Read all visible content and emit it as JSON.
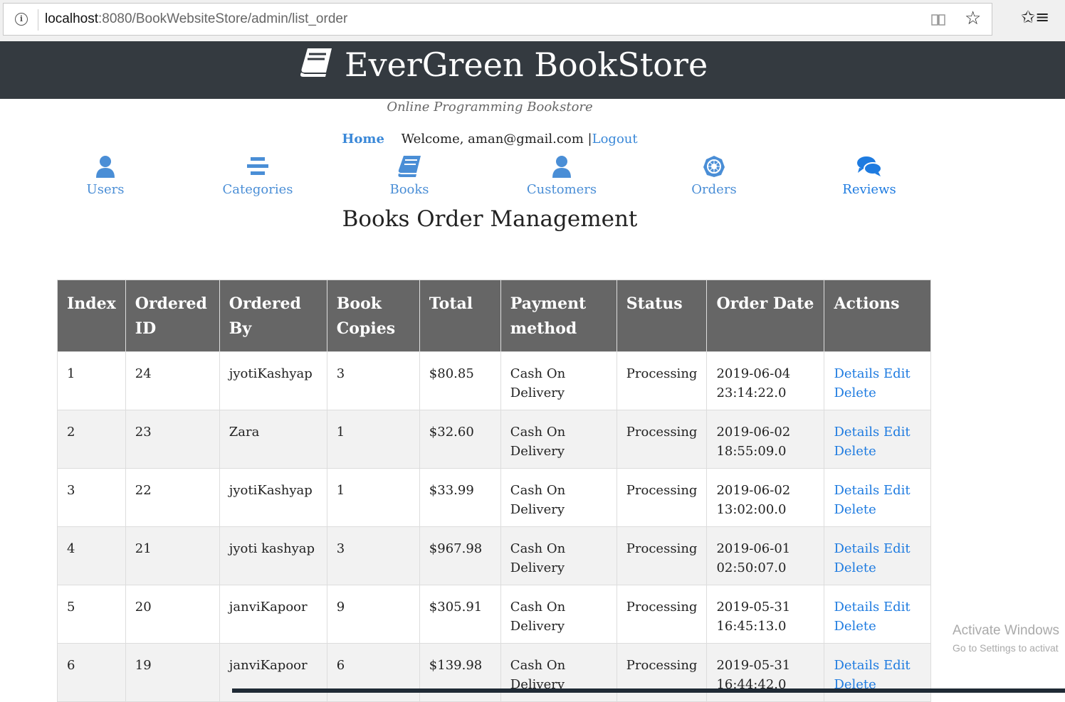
{
  "browser": {
    "url_host": "localhost",
    "url_rest": ":8080/BookWebsiteStore/admin/list_order",
    "info_icon": "info-icon",
    "star_icon": "star-icon",
    "favorites_icon": "favorites-icon"
  },
  "header": {
    "brand": "EverGreen BookStore",
    "tagline": "Online Programming Bookstore",
    "home_link": "Home",
    "welcome": "Welcome, aman@gmail.com |",
    "logout_link": "Logout"
  },
  "menu": [
    {
      "label": "Users",
      "icon": "user-icon"
    },
    {
      "label": "Categories",
      "icon": "bars-icon"
    },
    {
      "label": "Books",
      "icon": "book-icon"
    },
    {
      "label": "Customers",
      "icon": "user-icon"
    },
    {
      "label": "Orders",
      "icon": "gear-badge-icon"
    },
    {
      "label": "Reviews",
      "icon": "comments-icon"
    }
  ],
  "page_title": "Books Order Management",
  "table": {
    "headers": [
      "Index",
      "Ordered ID",
      "Ordered By",
      "Book Copies",
      "Total",
      "Payment method",
      "Status",
      "Order Date",
      "Actions"
    ],
    "rows": [
      {
        "index": "1",
        "id": "24",
        "by": "jyotiKashyap",
        "copies": "3",
        "total": "$80.85",
        "payment": "Cash On Delivery",
        "status": "Processing",
        "date": "2019-06-04 23:14:22.0"
      },
      {
        "index": "2",
        "id": "23",
        "by": "Zara",
        "copies": "1",
        "total": "$32.60",
        "payment": "Cash On Delivery",
        "status": "Processing",
        "date": "2019-06-02 18:55:09.0"
      },
      {
        "index": "3",
        "id": "22",
        "by": "jyotiKashyap",
        "copies": "1",
        "total": "$33.99",
        "payment": "Cash On Delivery",
        "status": "Processing",
        "date": "2019-06-02 13:02:00.0"
      },
      {
        "index": "4",
        "id": "21",
        "by": "jyoti kashyap",
        "copies": "3",
        "total": "$967.98",
        "payment": "Cash On Delivery",
        "status": "Processing",
        "date": "2019-06-01 02:50:07.0"
      },
      {
        "index": "5",
        "id": "20",
        "by": "janviKapoor",
        "copies": "9",
        "total": "$305.91",
        "payment": "Cash On Delivery",
        "status": "Processing",
        "date": "2019-05-31 16:45:13.0"
      },
      {
        "index": "6",
        "id": "19",
        "by": "janviKapoor",
        "copies": "6",
        "total": "$139.98",
        "payment": "Cash On Delivery",
        "status": "Processing",
        "date": "2019-05-31 16:44:42.0"
      }
    ],
    "actions": {
      "details": "Details",
      "edit": "Edit",
      "delete": "Delete"
    }
  },
  "watermark": {
    "line1": "Activate Windows",
    "line2": "Go to Settings to activat"
  },
  "colors": {
    "banner": "#343a40",
    "link": "#1e7be0",
    "menu_icon": "#4a8ed6",
    "table_header": "#666666"
  }
}
